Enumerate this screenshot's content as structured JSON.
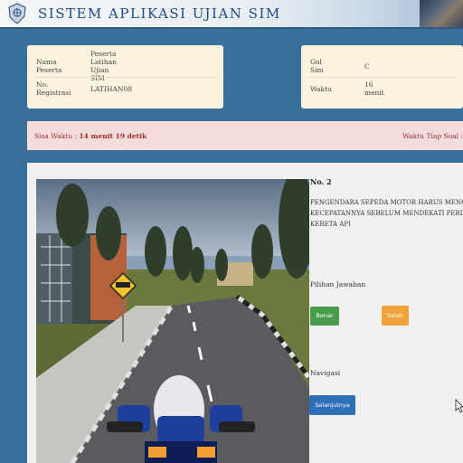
{
  "header": {
    "title": "SISTEM APLIKASI UJIAN SIM"
  },
  "participant": {
    "name_label": "Nama Peserta",
    "name_value": "Peserta Latihan Ujian SIM",
    "reg_label": "No. Registrasi",
    "reg_value": "LATIHAN08"
  },
  "exam": {
    "class_label": "Gol Sim",
    "class_value": "C",
    "time_label": "Waktu",
    "time_value": "16 menit"
  },
  "timer": {
    "remaining_label": "Sisa Waktu :",
    "remaining_value": "14 menit 19 detik",
    "per_question_label": "Waktu Tiap Soal :"
  },
  "question": {
    "number": "No. 2",
    "line1": "PENGENDARA SEPEDA MOTOR HARUS MENGURANGI",
    "line2": "KECEPATANNYA SEBELUM MENDEKATI PERLINTASAN",
    "line3": "KERETA API"
  },
  "answers": {
    "label": "Pilihan Jawaban",
    "true_label": "Benar",
    "false_label": "Salah"
  },
  "navigation": {
    "label": "Navigasi",
    "next_label": "Selanjutnya"
  },
  "colors": {
    "header_blue": "#1d4a86",
    "background": "#3a6f9a",
    "true_button": "#4a9b4a",
    "false_button": "#f0a33a",
    "next_button": "#2f6fb8",
    "timer_text": "#9a2f2f"
  }
}
